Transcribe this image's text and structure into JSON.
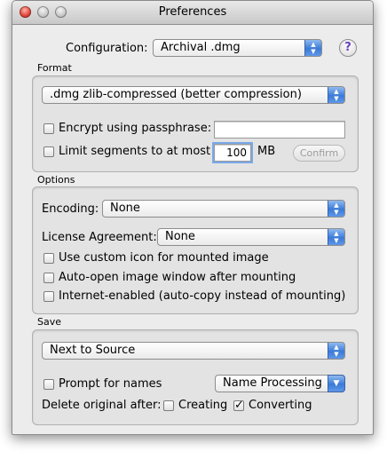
{
  "window": {
    "title": "Preferences"
  },
  "configuration": {
    "label": "Configuration:",
    "value": "Archival .dmg",
    "help_glyph": "?"
  },
  "format": {
    "title": "Format",
    "image_format": ".dmg zlib-compressed (better compression)",
    "encrypt": {
      "label": "Encrypt using passphrase:",
      "checked": false,
      "passphrase": ""
    },
    "limit": {
      "label": "Limit segments to at most",
      "checked": false,
      "value": "100",
      "unit": "MB",
      "confirm_label": "Confirm"
    }
  },
  "options": {
    "title": "Options",
    "encoding": {
      "label": "Encoding:",
      "value": "None"
    },
    "license": {
      "label": "License Agreement:",
      "value": "None"
    },
    "custom_icon": {
      "label": "Use custom icon for mounted image",
      "checked": false
    },
    "auto_open": {
      "label": "Auto-open image window after mounting",
      "checked": false
    },
    "internet": {
      "label": "Internet-enabled (auto-copy instead of mounting)",
      "checked": false
    }
  },
  "save": {
    "title": "Save",
    "location": "Next to Source",
    "prompt": {
      "label": "Prompt for names",
      "checked": false
    },
    "name_processing": "Name Processing",
    "delete_label": "Delete original after:",
    "creating": {
      "label": "Creating",
      "checked": false
    },
    "converting": {
      "label": "Converting",
      "checked": true
    }
  },
  "icons": {
    "popup_arrows": "up-down-arrows-icon",
    "pulldown_arrow": "down-triangle-icon",
    "checkmark": "checkmark-icon"
  },
  "colors": {
    "accent": "#3a7ad8",
    "window_bg": "#ececec",
    "help": "#6a3fbf"
  }
}
